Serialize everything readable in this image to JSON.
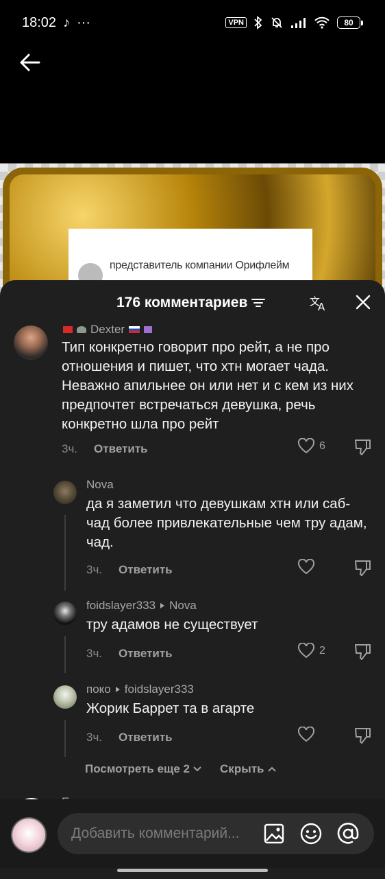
{
  "status_bar": {
    "time": "18:02",
    "more": "···",
    "vpn": "VPN",
    "battery": "80"
  },
  "preview": {
    "caption": "представитель компании Орифлейм"
  },
  "sheet": {
    "title": "176 комментариев"
  },
  "comments": [
    {
      "username": "Dexter",
      "text": "Тип конкретно говорит про рейт, а не про отношения и пишет, что хтн могает чада. Неважно апильнее он или нет и с кем из них предпочтет встречаться девушка, речь конкретно шла про рейт",
      "time": "3ч.",
      "reply": "Ответить",
      "likes": "6"
    }
  ],
  "replies": [
    {
      "username": "Nova",
      "reply_to": "",
      "text": "да я заметил что девушкам хтн или саб-чад более привлекательные чем тру адам, чад.",
      "time": "3ч.",
      "reply": "Ответить",
      "likes": ""
    },
    {
      "username": "foidslayer333",
      "reply_to": "Nova",
      "text": "тру адамов не существует",
      "time": "3ч.",
      "reply": "Ответить",
      "likes": "2"
    },
    {
      "username": "поко",
      "reply_to": "foidslayer333",
      "text": "Жорик Баррет та в агарте",
      "time": "3ч.",
      "reply": "Ответить",
      "likes": ""
    }
  ],
  "thread_controls": {
    "view_more": "Посмотреть еще 2",
    "hide": "Скрыть"
  },
  "next_comment": {
    "username": "Evoreo"
  },
  "input": {
    "placeholder": "Добавить комментарий..."
  },
  "colors": {
    "sheet_bg": "#1f1f1f",
    "text": "#f2f2f2",
    "muted": "#8a8a8a"
  }
}
